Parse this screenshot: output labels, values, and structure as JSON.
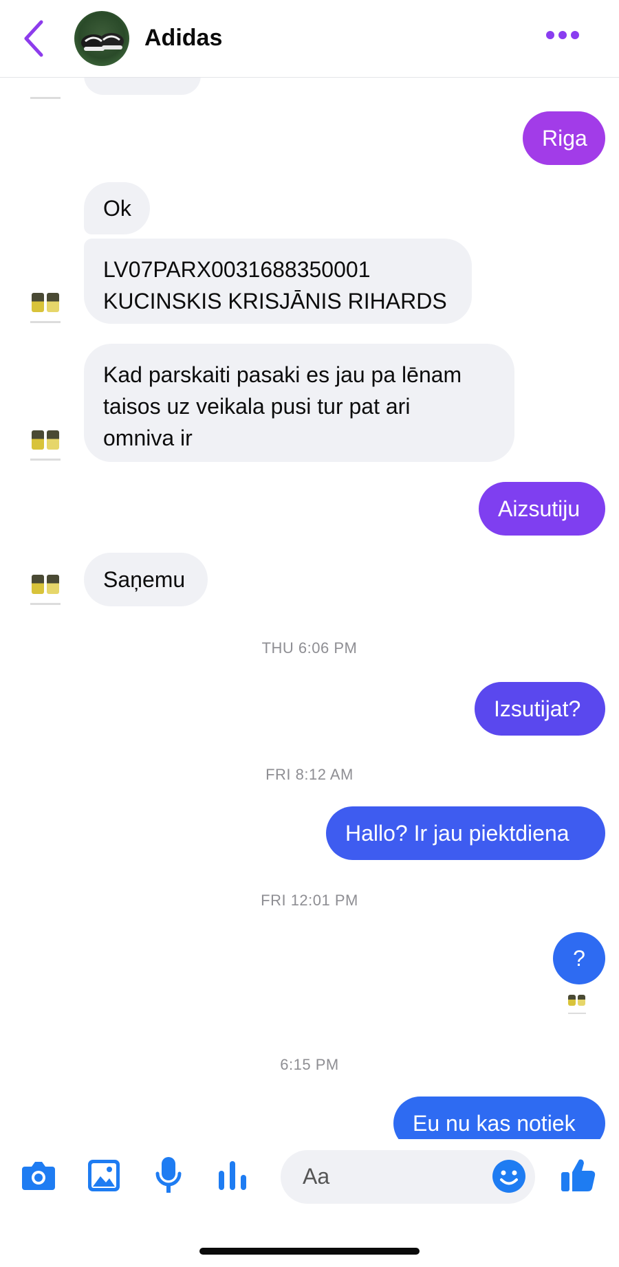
{
  "header": {
    "title": "Adidas"
  },
  "messages": {
    "riga": "Riga",
    "ok": "Ok",
    "account_line1": "LV07PARX0031688350001",
    "account_line2": "KUCINSKIS KRISJĀNIS RIHARDS",
    "kad_line1": "Kad parskaiti pasaki es jau pa lēnam",
    "kad_line2": "taisos uz veikala pusi tur pat ari",
    "kad_line3": "omniva ir",
    "aizsutiju": "Aizsutiju",
    "sanemu": "Saņemu",
    "izsutijat": "Izsutijat?",
    "hallo": "Hallo? Ir jau piektdiena",
    "question": "?",
    "eu": "Eu nu kas notiek"
  },
  "timestamps": {
    "thu": "THU 6:06 PM",
    "fri_am": "FRI 8:12 AM",
    "fri_pm": "FRI 12:01 PM",
    "last": "6:15 PM"
  },
  "composer": {
    "placeholder": "Aa"
  },
  "colors": {
    "purple": "#a23ce8",
    "violet": "#7f3ff0",
    "indigo": "#5a48ee",
    "blue": "#3e5cf0",
    "bright_blue": "#2e6bf2",
    "icon_blue": "#1e7cf2"
  }
}
